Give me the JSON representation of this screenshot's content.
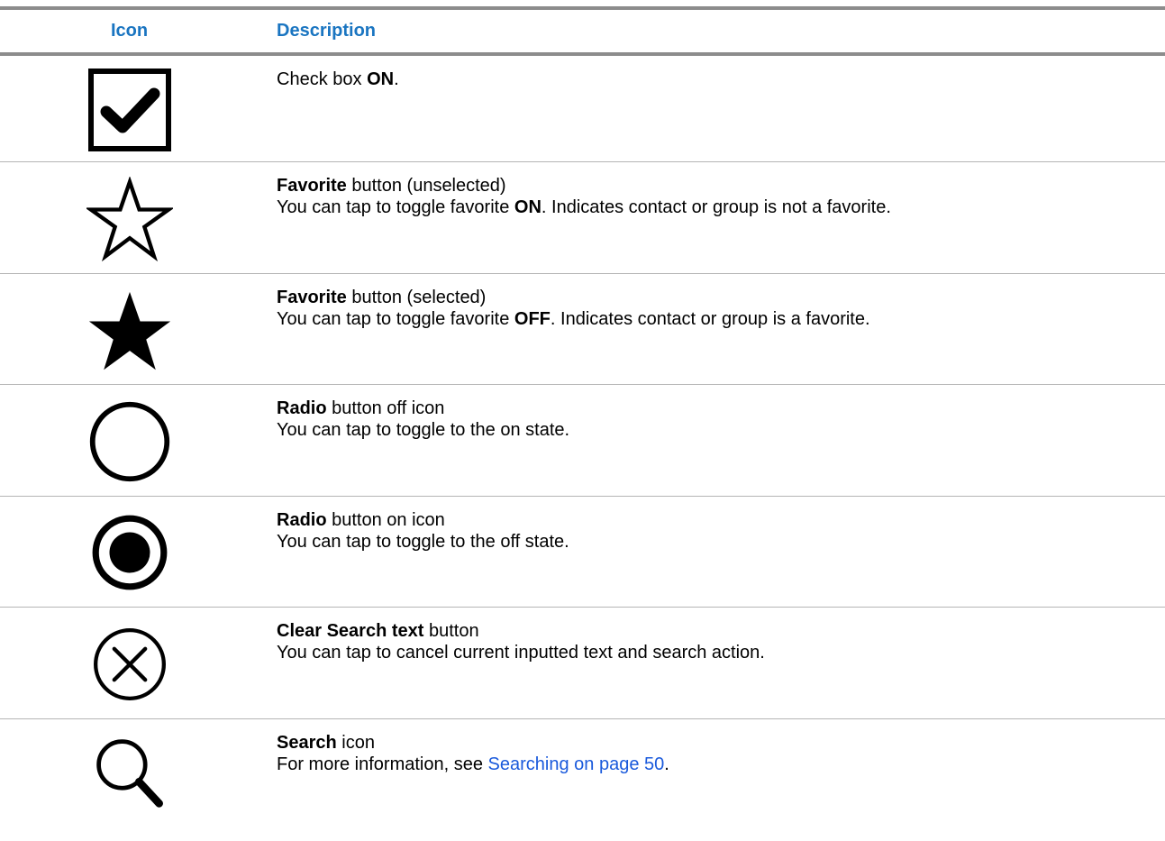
{
  "table": {
    "headers": {
      "icon": "Icon",
      "description": "Description"
    },
    "rows": [
      {
        "icon": "checkbox-checked-icon",
        "title_bold": "",
        "title_rest": "Check box ",
        "title_bold_2": "ON",
        "title_tail": ".",
        "line2_pre": "",
        "line2_bold": "",
        "line2_post": ""
      },
      {
        "icon": "star-outline-icon",
        "title_bold": "Favorite",
        "title_rest": " button (unselected)",
        "line2_pre": "You can tap to toggle favorite ",
        "line2_bold": "ON",
        "line2_post": ". Indicates contact or group is not a favorite."
      },
      {
        "icon": "star-filled-icon",
        "title_bold": "Favorite",
        "title_rest": " button (selected)",
        "line2_pre": "You can tap to toggle favorite ",
        "line2_bold": "OFF",
        "line2_post": ". Indicates contact or group is a favorite."
      },
      {
        "icon": "radio-off-icon",
        "title_bold": "Radio",
        "title_rest": " button off icon",
        "line2_pre": "You can tap to toggle to the on state.",
        "line2_bold": "",
        "line2_post": ""
      },
      {
        "icon": "radio-on-icon",
        "title_bold": "Radio",
        "title_rest": " button on icon",
        "line2_pre": "You can tap to toggle to the off state.",
        "line2_bold": "",
        "line2_post": ""
      },
      {
        "icon": "clear-search-icon",
        "title_bold": "Clear Search text",
        "title_rest": " button",
        "line2_pre": "You can tap to cancel current inputted text and search action.",
        "line2_bold": "",
        "line2_post": ""
      },
      {
        "icon": "search-icon",
        "title_bold": "Search",
        "title_rest": " icon",
        "line2_pre": "For more information, see ",
        "line2_link": "Searching on page 50",
        "line2_post": "."
      }
    ]
  },
  "colors": {
    "header_text": "#1a75c1",
    "link": "#1a5adc",
    "rule": "#8c8c8c",
    "row_divider": "#b5b5b5"
  }
}
